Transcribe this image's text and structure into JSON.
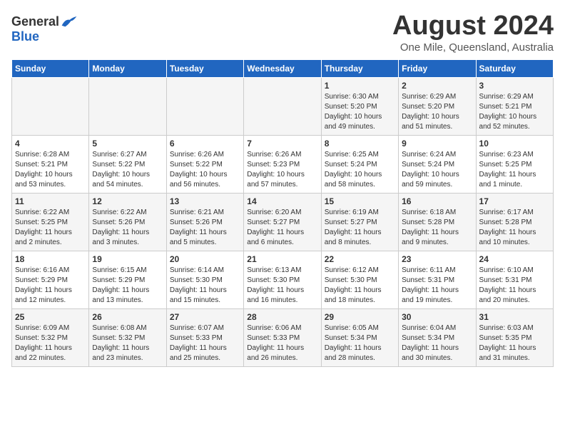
{
  "header": {
    "logo_general": "General",
    "logo_blue": "Blue",
    "main_title": "August 2024",
    "subtitle": "One Mile, Queensland, Australia"
  },
  "calendar": {
    "days_of_week": [
      "Sunday",
      "Monday",
      "Tuesday",
      "Wednesday",
      "Thursday",
      "Friday",
      "Saturday"
    ],
    "weeks": [
      [
        {
          "day": "",
          "info": ""
        },
        {
          "day": "",
          "info": ""
        },
        {
          "day": "",
          "info": ""
        },
        {
          "day": "",
          "info": ""
        },
        {
          "day": "1",
          "info": "Sunrise: 6:30 AM\nSunset: 5:20 PM\nDaylight: 10 hours\nand 49 minutes."
        },
        {
          "day": "2",
          "info": "Sunrise: 6:29 AM\nSunset: 5:20 PM\nDaylight: 10 hours\nand 51 minutes."
        },
        {
          "day": "3",
          "info": "Sunrise: 6:29 AM\nSunset: 5:21 PM\nDaylight: 10 hours\nand 52 minutes."
        }
      ],
      [
        {
          "day": "4",
          "info": "Sunrise: 6:28 AM\nSunset: 5:21 PM\nDaylight: 10 hours\nand 53 minutes."
        },
        {
          "day": "5",
          "info": "Sunrise: 6:27 AM\nSunset: 5:22 PM\nDaylight: 10 hours\nand 54 minutes."
        },
        {
          "day": "6",
          "info": "Sunrise: 6:26 AM\nSunset: 5:22 PM\nDaylight: 10 hours\nand 56 minutes."
        },
        {
          "day": "7",
          "info": "Sunrise: 6:26 AM\nSunset: 5:23 PM\nDaylight: 10 hours\nand 57 minutes."
        },
        {
          "day": "8",
          "info": "Sunrise: 6:25 AM\nSunset: 5:24 PM\nDaylight: 10 hours\nand 58 minutes."
        },
        {
          "day": "9",
          "info": "Sunrise: 6:24 AM\nSunset: 5:24 PM\nDaylight: 10 hours\nand 59 minutes."
        },
        {
          "day": "10",
          "info": "Sunrise: 6:23 AM\nSunset: 5:25 PM\nDaylight: 11 hours\nand 1 minute."
        }
      ],
      [
        {
          "day": "11",
          "info": "Sunrise: 6:22 AM\nSunset: 5:25 PM\nDaylight: 11 hours\nand 2 minutes."
        },
        {
          "day": "12",
          "info": "Sunrise: 6:22 AM\nSunset: 5:26 PM\nDaylight: 11 hours\nand 3 minutes."
        },
        {
          "day": "13",
          "info": "Sunrise: 6:21 AM\nSunset: 5:26 PM\nDaylight: 11 hours\nand 5 minutes."
        },
        {
          "day": "14",
          "info": "Sunrise: 6:20 AM\nSunset: 5:27 PM\nDaylight: 11 hours\nand 6 minutes."
        },
        {
          "day": "15",
          "info": "Sunrise: 6:19 AM\nSunset: 5:27 PM\nDaylight: 11 hours\nand 8 minutes."
        },
        {
          "day": "16",
          "info": "Sunrise: 6:18 AM\nSunset: 5:28 PM\nDaylight: 11 hours\nand 9 minutes."
        },
        {
          "day": "17",
          "info": "Sunrise: 6:17 AM\nSunset: 5:28 PM\nDaylight: 11 hours\nand 10 minutes."
        }
      ],
      [
        {
          "day": "18",
          "info": "Sunrise: 6:16 AM\nSunset: 5:29 PM\nDaylight: 11 hours\nand 12 minutes."
        },
        {
          "day": "19",
          "info": "Sunrise: 6:15 AM\nSunset: 5:29 PM\nDaylight: 11 hours\nand 13 minutes."
        },
        {
          "day": "20",
          "info": "Sunrise: 6:14 AM\nSunset: 5:30 PM\nDaylight: 11 hours\nand 15 minutes."
        },
        {
          "day": "21",
          "info": "Sunrise: 6:13 AM\nSunset: 5:30 PM\nDaylight: 11 hours\nand 16 minutes."
        },
        {
          "day": "22",
          "info": "Sunrise: 6:12 AM\nSunset: 5:30 PM\nDaylight: 11 hours\nand 18 minutes."
        },
        {
          "day": "23",
          "info": "Sunrise: 6:11 AM\nSunset: 5:31 PM\nDaylight: 11 hours\nand 19 minutes."
        },
        {
          "day": "24",
          "info": "Sunrise: 6:10 AM\nSunset: 5:31 PM\nDaylight: 11 hours\nand 20 minutes."
        }
      ],
      [
        {
          "day": "25",
          "info": "Sunrise: 6:09 AM\nSunset: 5:32 PM\nDaylight: 11 hours\nand 22 minutes."
        },
        {
          "day": "26",
          "info": "Sunrise: 6:08 AM\nSunset: 5:32 PM\nDaylight: 11 hours\nand 23 minutes."
        },
        {
          "day": "27",
          "info": "Sunrise: 6:07 AM\nSunset: 5:33 PM\nDaylight: 11 hours\nand 25 minutes."
        },
        {
          "day": "28",
          "info": "Sunrise: 6:06 AM\nSunset: 5:33 PM\nDaylight: 11 hours\nand 26 minutes."
        },
        {
          "day": "29",
          "info": "Sunrise: 6:05 AM\nSunset: 5:34 PM\nDaylight: 11 hours\nand 28 minutes."
        },
        {
          "day": "30",
          "info": "Sunrise: 6:04 AM\nSunset: 5:34 PM\nDaylight: 11 hours\nand 30 minutes."
        },
        {
          "day": "31",
          "info": "Sunrise: 6:03 AM\nSunset: 5:35 PM\nDaylight: 11 hours\nand 31 minutes."
        }
      ]
    ]
  }
}
